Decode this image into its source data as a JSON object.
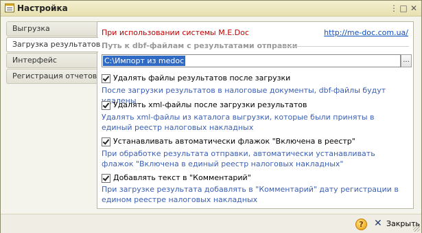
{
  "window": {
    "title": "Настройка",
    "controls": [
      "⋮",
      "□",
      "✕"
    ]
  },
  "tabs": [
    {
      "label": "Выгрузка",
      "active": false
    },
    {
      "label": "Загрузка результатов",
      "active": true
    },
    {
      "label": "Интерфейс",
      "active": false
    },
    {
      "label": "Регистрация отчетов",
      "active": false
    }
  ],
  "panel": {
    "notice": "При использовании системы M.E.Doc",
    "link": "http://me-doc.com.ua/",
    "path_section_label": "Путь к dbf-файлам с результатами отправки",
    "path_value": "C:\\Импорт из medoc",
    "browse_label": "...",
    "options": [
      {
        "label": "Удалять файлы результатов после загрузки",
        "checked": true,
        "description": "После загрузки результатов в налоговые документы, dbf-файлы будут удалены"
      },
      {
        "label": "Удалять xml-файлы после загрузки результатов",
        "checked": true,
        "description": "Удалять xml-файлы из каталога выгрузки, которые были приняты в единый реестр налоговых накладных"
      },
      {
        "label": "Устанавливать автоматически флажок \"Включена в реестр\"",
        "checked": true,
        "description": "При обработке результата отправки, автоматически устанавливать флажок \"Включена в единый реестр налоговых накладных\""
      },
      {
        "label": "Добавлять текст в \"Комментарий\"",
        "checked": true,
        "description": "При загрузке результата добавлять в \"Комментарий\" дату регистрации в едином реестре налоговых накладных"
      }
    ]
  },
  "footer": {
    "help_label": "?",
    "close_label": "Закрыть"
  },
  "colors": {
    "notice": "#c00000",
    "link": "#0b4fbf",
    "description": "#3a5fb5",
    "selection": "#316ac5",
    "titlebar": "#ebe5b8"
  },
  "icons": {
    "title": "settings-form-icon",
    "help": "help-icon",
    "close": "close-icon"
  }
}
